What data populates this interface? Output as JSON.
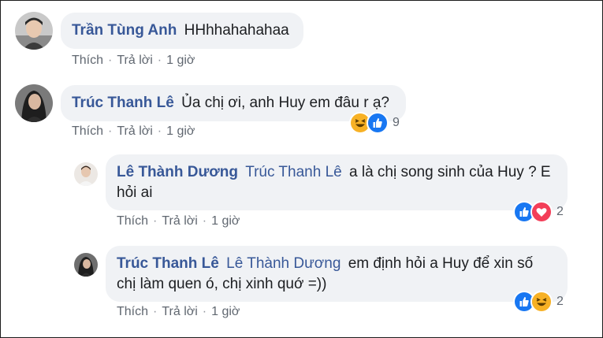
{
  "comments": [
    {
      "author": "Trần Tùng Anh",
      "mention": "",
      "text": "HHhhahahahaa",
      "actions": {
        "like": "Thích",
        "reply": "Trả lời",
        "time": "1 giờ"
      }
    },
    {
      "author": "Trúc Thanh Lê",
      "mention": "",
      "text": "Ủa chị ơi, anh Huy em đâu r ạ?",
      "actions": {
        "like": "Thích",
        "reply": "Trả lời",
        "time": "1 giờ"
      },
      "reactions": {
        "icons": [
          "haha-icon",
          "like-icon"
        ],
        "count": "9"
      }
    }
  ],
  "replies": [
    {
      "author": "Lê Thành Dương",
      "mention": "Trúc Thanh Lê",
      "text_line1": "a là chị song sinh của Huy ? E",
      "text_line2": "hỏi ai",
      "actions": {
        "like": "Thích",
        "reply": "Trả lời",
        "time": "1 giờ"
      },
      "reactions": {
        "icons": [
          "like-icon",
          "love-icon"
        ],
        "count": "2"
      }
    },
    {
      "author": "Trúc Thanh Lê",
      "mention": "Lê Thành Dương",
      "text_line1": "em định hỏi a Huy để xin số",
      "text_line2": "chị làm quen ó, chị xinh quớ =))",
      "actions": {
        "like": "Thích",
        "reply": "Trả lời",
        "time": "1 giờ"
      },
      "reactions": {
        "icons": [
          "like-icon",
          "haha-icon"
        ],
        "count": "2"
      }
    }
  ],
  "colors": {
    "author": "#385898",
    "bubble": "#f0f2f5",
    "meta": "#606770",
    "like": "#1877f2",
    "love": "#f33e58",
    "haha": "#f7b125"
  }
}
